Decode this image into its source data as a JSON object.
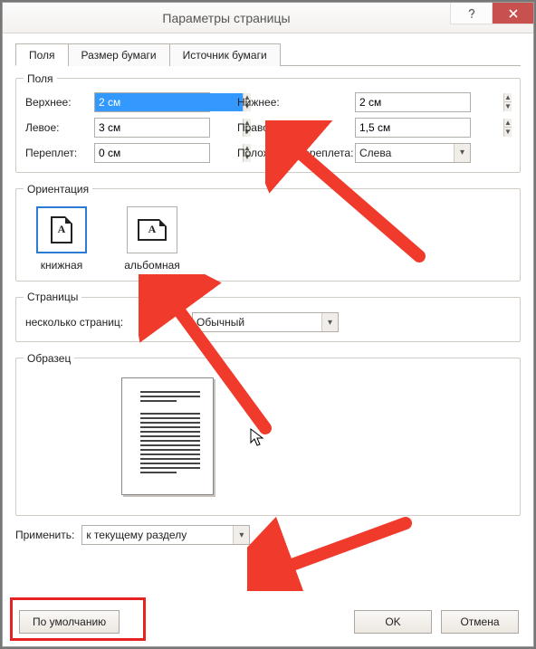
{
  "window": {
    "title": "Параметры страницы"
  },
  "tabs": {
    "t1": "Поля",
    "t2": "Размер бумаги",
    "t3": "Источник бумаги"
  },
  "margins": {
    "group_label": "Поля",
    "top_label": "Верхнее:",
    "top_value": "2 см",
    "bottom_label": "Нижнее:",
    "bottom_value": "2 см",
    "left_label": "Левое:",
    "left_value": "3 см",
    "right_label": "Правое:",
    "right_value": "1,5 см",
    "gutter_label": "Переплет:",
    "gutter_value": "0 см",
    "gutter_pos_label": "Положение переплета:",
    "gutter_pos_value": "Слева"
  },
  "orientation": {
    "group_label": "Ориентация",
    "portrait": "книжная",
    "landscape": "альбомная"
  },
  "pages": {
    "group_label": "Страницы",
    "multi_label": "несколько страниц:",
    "multi_value": "Обычный"
  },
  "preview": {
    "group_label": "Образец"
  },
  "apply": {
    "label": "Применить:",
    "value": "к текущему разделу"
  },
  "buttons": {
    "default": "По умолчанию",
    "ok": "OK",
    "cancel": "Отмена"
  }
}
